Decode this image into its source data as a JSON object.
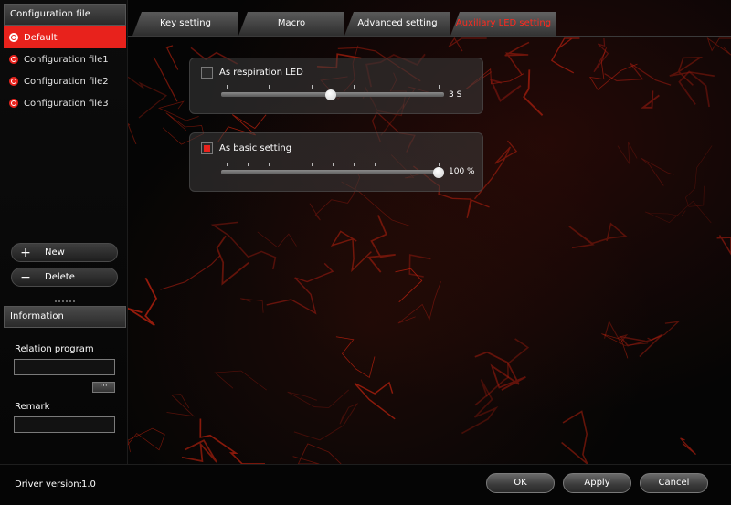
{
  "sidebar": {
    "config_header": "Configuration file",
    "configs": [
      {
        "label": "Default",
        "selected": true
      },
      {
        "label": "Configuration file1",
        "selected": false
      },
      {
        "label": "Configuration file2",
        "selected": false
      },
      {
        "label": "Configuration file3",
        "selected": false
      }
    ],
    "new_label": "New",
    "delete_label": "Delete",
    "new_icon": "plus-icon",
    "delete_icon": "minus-icon",
    "info_header": "Information",
    "relation_label": "Relation program",
    "relation_value": "",
    "browse_label": "···",
    "remark_label": "Remark",
    "remark_value": ""
  },
  "tabs": [
    {
      "label": "Key setting",
      "active": false
    },
    {
      "label": "Macro",
      "active": false
    },
    {
      "label": "Advanced setting",
      "active": false
    },
    {
      "label": "Auxiliary LED setting",
      "active": true
    }
  ],
  "led": {
    "respiration": {
      "label": "As respiration LED",
      "checked": false,
      "value_text": "3 S",
      "level": 0.49
    },
    "basic": {
      "label": "As basic setting",
      "checked": true,
      "value_text": "100 %",
      "level": 1.0
    }
  },
  "footer": {
    "driver_label": "Driver version:",
    "driver_value": "1.0",
    "ok_label": "OK",
    "apply_label": "Apply",
    "cancel_label": "Cancel"
  },
  "colors": {
    "accent": "#e8221c",
    "active_tab_text": "#ff2a1e",
    "background": "#000000"
  }
}
